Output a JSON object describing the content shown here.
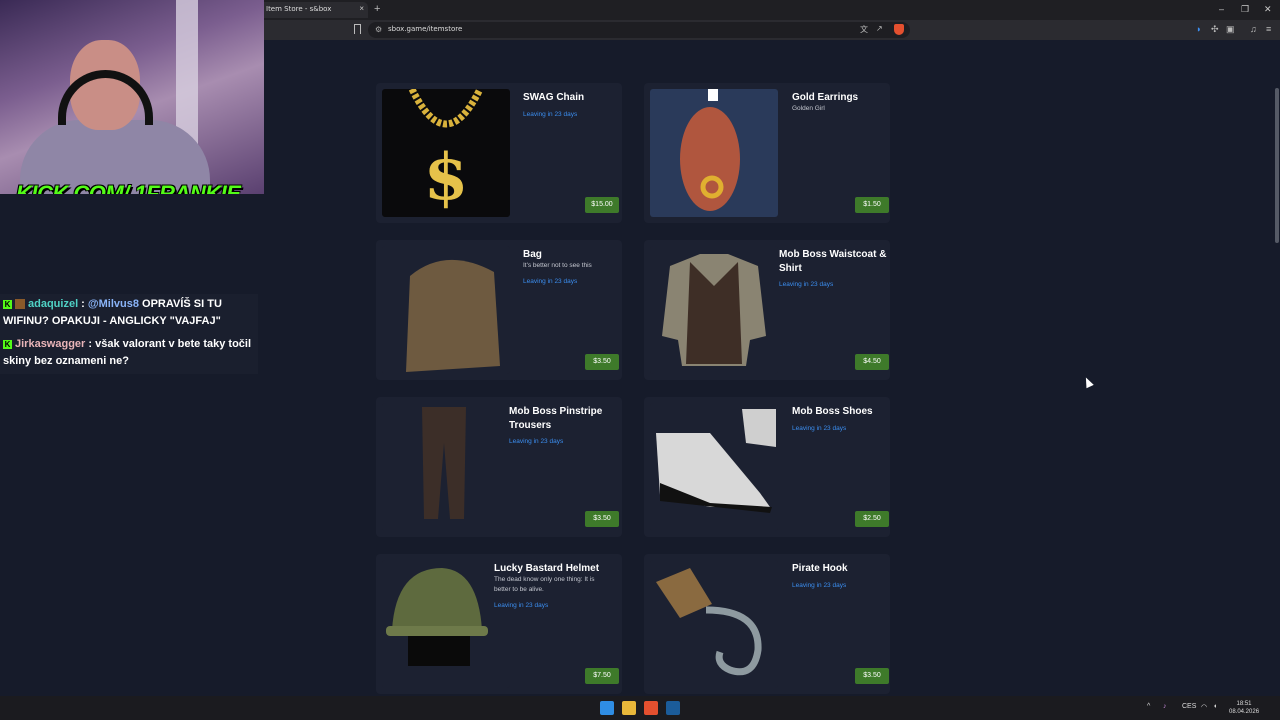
{
  "browser": {
    "tab_title": "Item Store - s&box",
    "tab_close": "×",
    "new_tab": "+",
    "url": "sbox.game/itemstore",
    "window_controls": [
      "–",
      "❐",
      "✕"
    ]
  },
  "stream": {
    "kick_text": "KICK.COM/ 1FRANKIE",
    "chat": [
      {
        "user": "adaquizel",
        "separator": " : ",
        "mention": "@Milvus8",
        "text": " OPRAVÍŠ SI TU WIFINU? OPAKUJI - ANGLICKY \"VAJFAJ\""
      },
      {
        "user": "Jirkaswagger",
        "separator": " : ",
        "mention": "",
        "text": "však valorant v bete taky točil skiny bez oznameni ne?"
      }
    ]
  },
  "items": [
    {
      "name": "SWAG Chain",
      "description": "",
      "leaving": "Leaving in 23 days",
      "price": "$15.00"
    },
    {
      "name": "Gold Earrings",
      "description": "Golden Girl",
      "leaving": "",
      "price": "$1.50"
    },
    {
      "name": "Bag",
      "description": "It's better not to see this",
      "leaving": "Leaving in 23 days",
      "price": "$3.50"
    },
    {
      "name": "Mob Boss Waistcoat & Shirt",
      "description": "",
      "leaving": "Leaving in 23 days",
      "price": "$4.50"
    },
    {
      "name": "Mob Boss Pinstripe Trousers",
      "description": "",
      "leaving": "Leaving in 23 days",
      "price": "$3.50"
    },
    {
      "name": "Mob Boss Shoes",
      "description": "",
      "leaving": "Leaving in 23 days",
      "price": "$2.50"
    },
    {
      "name": "Lucky Bastard Helmet",
      "description": "The dead know only one thing: It is better to be alive.",
      "leaving": "Leaving in 23 days",
      "price": "$7.50"
    },
    {
      "name": "Pirate Hook",
      "description": "",
      "leaving": "Leaving in 23 days",
      "price": "$3.50"
    }
  ],
  "taskbar": {
    "language": "CES",
    "time": "18:51",
    "date": "08.04.2026"
  },
  "colors": {
    "page_bg": "#161b2a",
    "card_bg": "#1c2131",
    "price_bg": "#3e7a2a",
    "leaving_text": "#3b8ef0",
    "kick_green": "#53fc18"
  }
}
